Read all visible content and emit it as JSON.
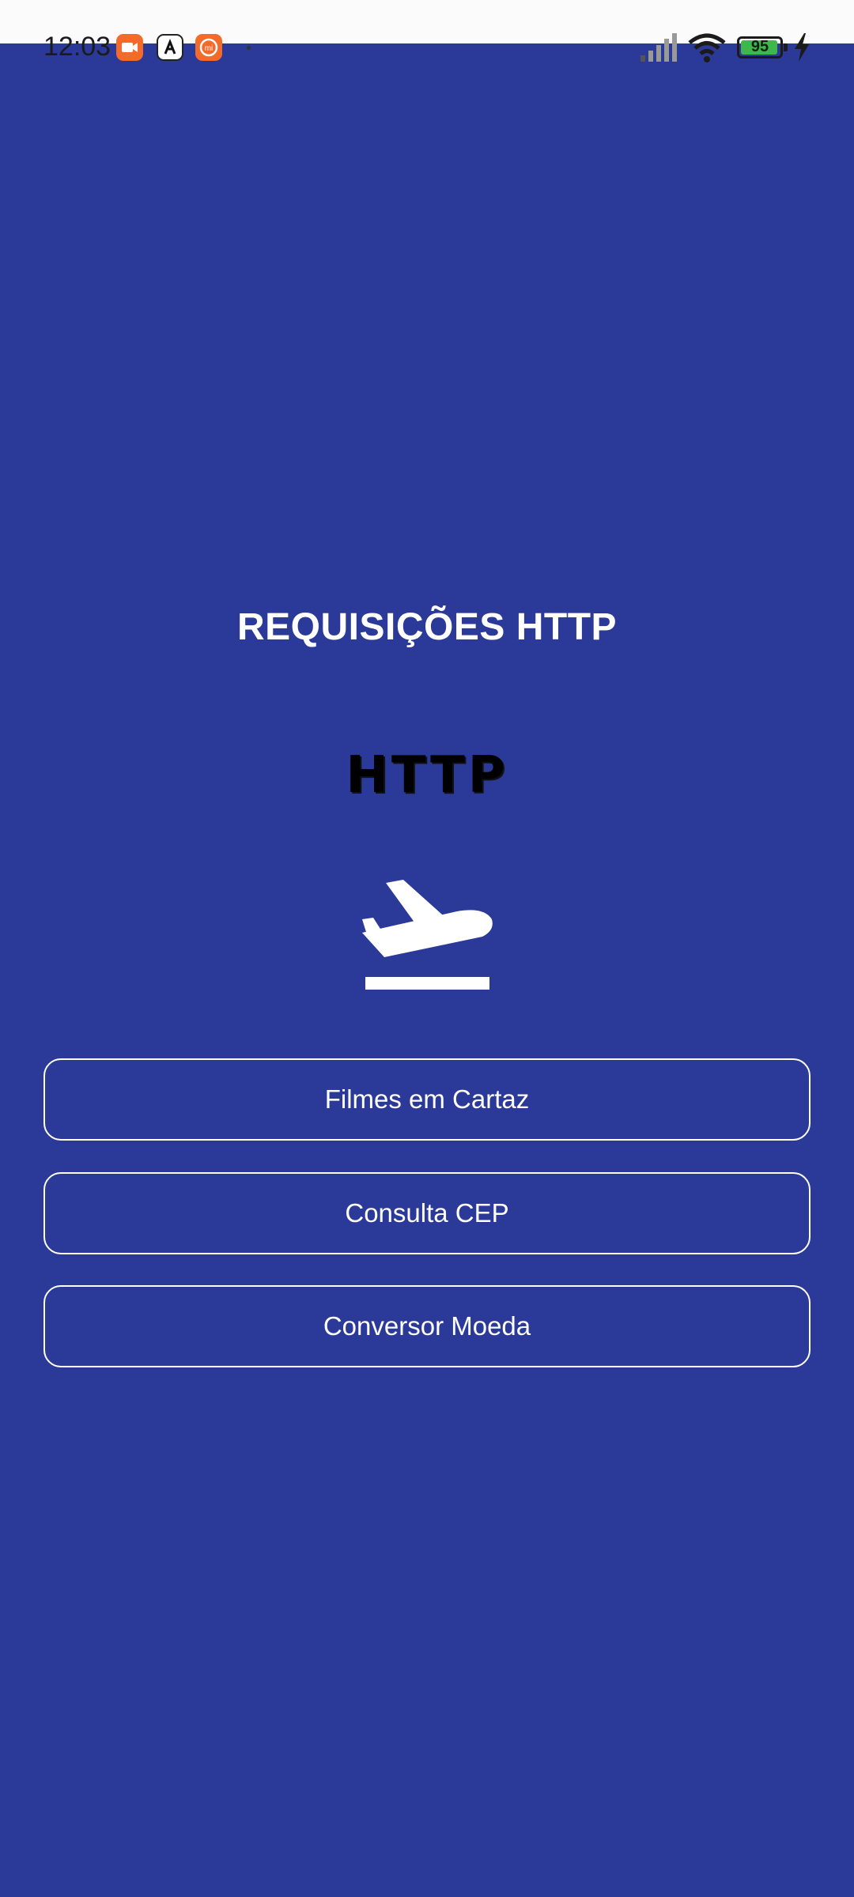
{
  "status_bar": {
    "time": "12:03",
    "battery_level": "95",
    "battery_fraction": 0.95,
    "icons": [
      "video-recorder-icon",
      "app-notification-icon",
      "mi-icon",
      "signal-icon",
      "wifi-icon",
      "battery-icon",
      "charging-icon"
    ]
  },
  "main": {
    "title": "REQUISIÇÕES HTTP",
    "logo_text": "HTTP",
    "hero_icon": "airplane-takeoff-icon"
  },
  "buttons": {
    "filmes": "Filmes em Cartaz",
    "cep": "Consulta CEP",
    "conversor": "Conversor Moeda"
  },
  "colors": {
    "background": "#2b3a98",
    "status_bar": "#fbfbfb",
    "button_border": "#ffffff",
    "text": "#ffffff",
    "battery": "#3fb84b",
    "notification_orange": "#f36a2b"
  }
}
